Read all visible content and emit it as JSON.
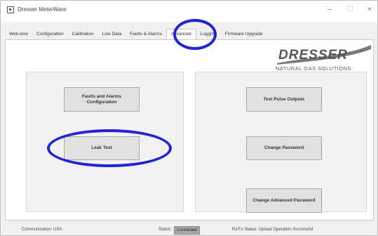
{
  "window": {
    "title": "Dresser MeterWare",
    "controls": {
      "minimize": "–",
      "maximize": "☐",
      "close": "×"
    }
  },
  "tabs": [
    {
      "label": "Welcome",
      "active": false
    },
    {
      "label": "Configuration",
      "active": false
    },
    {
      "label": "Calibration",
      "active": false
    },
    {
      "label": "Live Data",
      "active": false
    },
    {
      "label": "Faults & Alarms",
      "active": false
    },
    {
      "label": "Advanced",
      "active": true
    },
    {
      "label": "Logging",
      "active": false
    },
    {
      "label": "Firmware Upgrade",
      "active": false
    }
  ],
  "logo": {
    "word": "DRESSER",
    "subtitle": "NATURAL GAS SOLUTIONS"
  },
  "left_panel": {
    "faults_button": "Faults and Alarms\nConfiguration",
    "leak_button": "Leak Test"
  },
  "right_panel": {
    "pulse_button": "Test Pulse Outputs",
    "password_button": "Change Password",
    "advanced_password_button": "Change Advanced Password"
  },
  "status": {
    "communication": "Communication:  USA",
    "status_label": "Status:",
    "status_value": "Connected",
    "rxtx": "Rx/Tx Status:  Upload Operation Successful"
  },
  "colors": {
    "annotation": "#2222d6",
    "button_face": "#e1e1e1",
    "panel_bg": "#f2f2f2"
  }
}
